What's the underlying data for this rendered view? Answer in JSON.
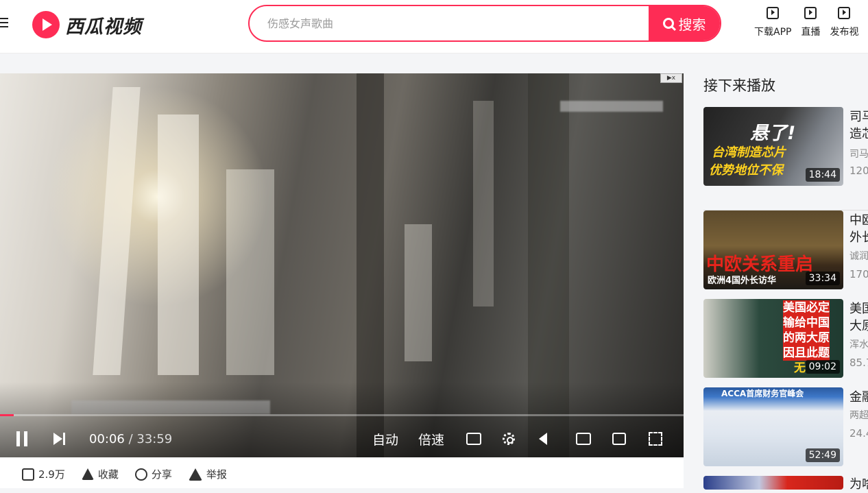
{
  "header": {
    "logo_text": "西瓜视频",
    "search_placeholder": "伤感女声歌曲",
    "search_button": "搜索",
    "actions": [
      {
        "label": "下载APP",
        "icon": "download-icon"
      },
      {
        "label": "直播",
        "icon": "live-tv-icon"
      },
      {
        "label": "发布视",
        "icon": "publish-video-icon"
      }
    ]
  },
  "player": {
    "ad_badge": "▶x",
    "current_time": "00:06",
    "separator": " / ",
    "duration": "33:59",
    "progress": 0.003,
    "auto_label": "自动",
    "speed_label": "倍速"
  },
  "video_actions": {
    "like": "2.9万",
    "favorite": "收藏",
    "share": "分享",
    "report": "举报"
  },
  "sidebar": {
    "title": "接下来播放",
    "items": [
      {
        "thumb_caption1": "悬了!",
        "thumb_caption2": "台湾制造芯片",
        "thumb_caption3": "优势地位不保",
        "duration": "18:44",
        "title_line1": "司马",
        "title_line2": "造芯",
        "author": "司马",
        "views": "120"
      },
      {
        "thumb_caption1": "中欧关系重启",
        "thumb_caption2": "欧洲4国外长访华",
        "duration": "33:34",
        "title_line1": "中欧",
        "title_line2": "外长",
        "author": "诚润",
        "views": "170"
      },
      {
        "thumb_caption1": "美国必定",
        "thumb_caption2": "输给中国",
        "thumb_caption3": "的两大原",
        "thumb_caption4": "因且此题",
        "thumb_caption5": "无",
        "duration": "09:02",
        "title_line1": "美国",
        "title_line2": "大原",
        "author": "浑水",
        "views": "85.7"
      },
      {
        "thumb_caption1": "ACCA首席财务官峰会",
        "duration": "52:49",
        "title_line1": "金融",
        "author": "两超",
        "views": "24.4"
      },
      {
        "title_line1": "为啥"
      }
    ]
  }
}
